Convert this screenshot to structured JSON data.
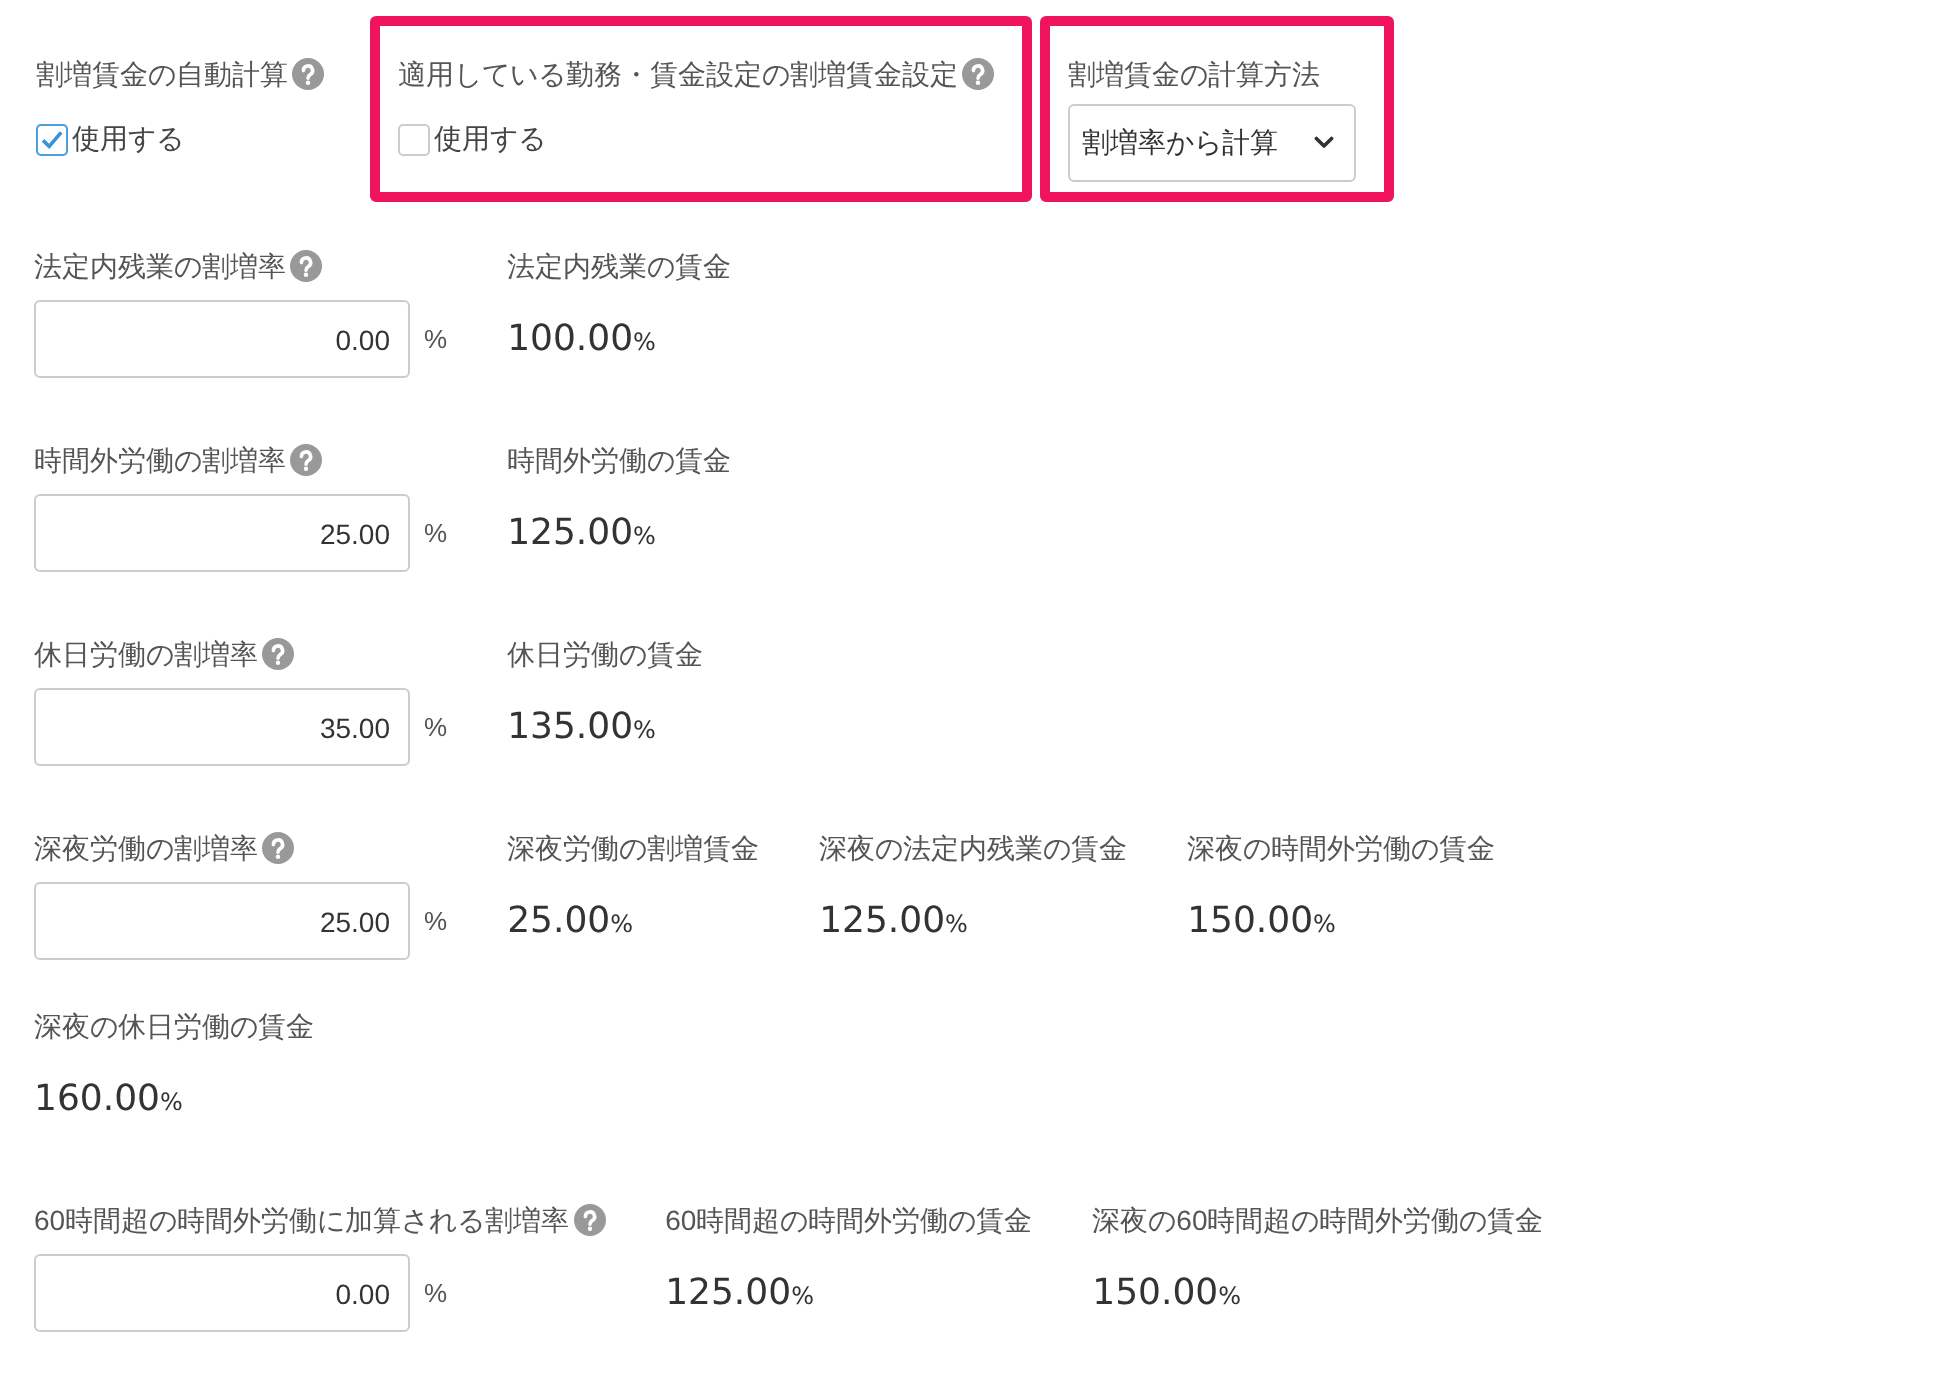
{
  "top_settings": [
    {
      "kind": "checkbox",
      "highlighted": false,
      "label": "割増賃金の自動計算",
      "help": true,
      "checkbox": {
        "label": "使用する",
        "checked": true
      }
    },
    {
      "kind": "checkbox",
      "highlighted": true,
      "label": "適用している勤務・賃金設定の割増賃金設定",
      "help": true,
      "checkbox": {
        "label": "使用する",
        "checked": false
      }
    },
    {
      "kind": "select",
      "highlighted": true,
      "label": "割増賃金の計算方法",
      "help": false,
      "select": {
        "value": "割増率から計算"
      }
    }
  ],
  "rate_groups": [
    {
      "rate": {
        "label": "法定内残業の割増率",
        "help": true,
        "value": "0.00",
        "unit": "%"
      },
      "wages": [
        {
          "label": "法定内残業の賃金",
          "value": "100.00",
          "unit": "%"
        }
      ]
    },
    {
      "rate": {
        "label": "時間外労働の割増率",
        "help": true,
        "value": "25.00",
        "unit": "%"
      },
      "wages": [
        {
          "label": "時間外労働の賃金",
          "value": "125.00",
          "unit": "%"
        }
      ]
    },
    {
      "rate": {
        "label": "休日労働の割増率",
        "help": true,
        "value": "35.00",
        "unit": "%"
      },
      "wages": [
        {
          "label": "休日労働の賃金",
          "value": "135.00",
          "unit": "%"
        }
      ]
    },
    {
      "rate": {
        "label": "深夜労働の割増率",
        "help": true,
        "value": "25.00",
        "unit": "%"
      },
      "wages": [
        {
          "label": "深夜労働の割増賃金",
          "value": "25.00",
          "unit": "%"
        },
        {
          "label": "深夜の法定内残業の賃金",
          "value": "125.00",
          "unit": "%"
        },
        {
          "label": "深夜の時間外労働の賃金",
          "value": "150.00",
          "unit": "%"
        },
        {
          "label": "深夜の休日労働の賃金",
          "value": "160.00",
          "unit": "%"
        }
      ]
    },
    {
      "rate": {
        "label": "60時間超の時間外労働に加算される割増率",
        "help": true,
        "value": "0.00",
        "unit": "%"
      },
      "wages": [
        {
          "label": "60時間超の時間外労働の賃金",
          "value": "125.00",
          "unit": "%"
        },
        {
          "label": "深夜の60時間超の時間外労働の賃金",
          "value": "150.00",
          "unit": "%"
        }
      ]
    }
  ]
}
